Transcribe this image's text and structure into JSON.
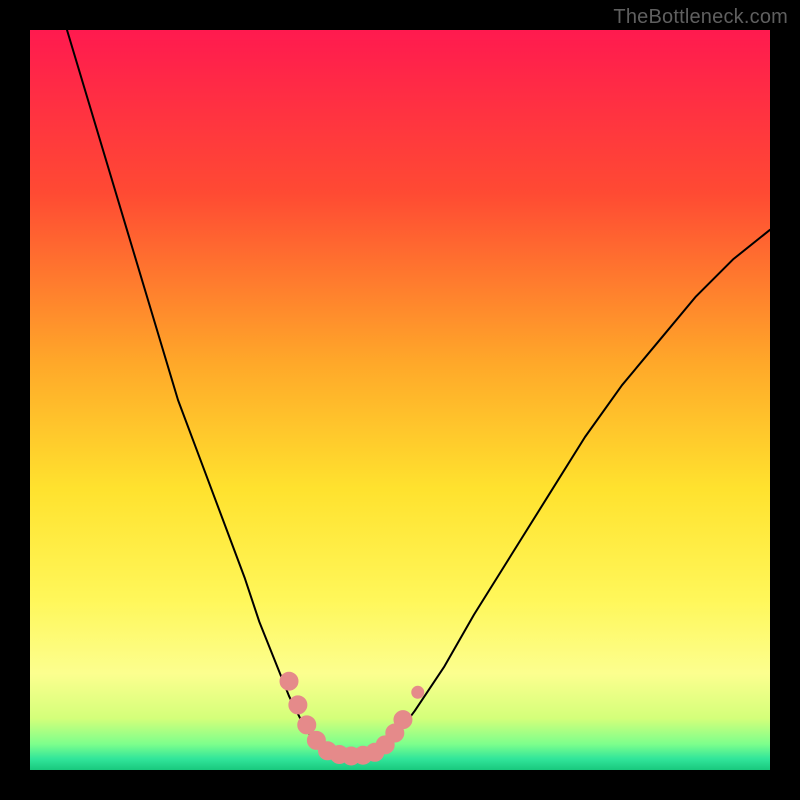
{
  "watermark": "TheBottleneck.com",
  "chart_data": {
    "type": "line",
    "title": "",
    "xlabel": "",
    "ylabel": "",
    "xlim": [
      0,
      100
    ],
    "ylim": [
      0,
      100
    ],
    "grid": false,
    "legend": false,
    "background_gradient_stops": [
      {
        "offset": 0,
        "color": "#ff1a4f"
      },
      {
        "offset": 0.22,
        "color": "#ff4a33"
      },
      {
        "offset": 0.45,
        "color": "#ffa829"
      },
      {
        "offset": 0.62,
        "color": "#ffe22e"
      },
      {
        "offset": 0.77,
        "color": "#fff75a"
      },
      {
        "offset": 0.87,
        "color": "#fcff8f"
      },
      {
        "offset": 0.93,
        "color": "#d4ff7a"
      },
      {
        "offset": 0.965,
        "color": "#7dff8c"
      },
      {
        "offset": 0.985,
        "color": "#31e59a"
      },
      {
        "offset": 1.0,
        "color": "#19c87d"
      }
    ],
    "series": [
      {
        "name": "left-curve",
        "stroke": "#000000",
        "stroke_width": 2,
        "x": [
          5,
          8,
          11,
          14,
          17,
          20,
          23,
          26,
          29,
          31,
          33,
          35,
          36.5,
          38,
          39,
          40
        ],
        "y": [
          100,
          90,
          80,
          70,
          60,
          50,
          42,
          34,
          26,
          20,
          15,
          10,
          7,
          4.5,
          3,
          2.5
        ]
      },
      {
        "name": "right-curve",
        "stroke": "#000000",
        "stroke_width": 2,
        "x": [
          47,
          49,
          52,
          56,
          60,
          65,
          70,
          75,
          80,
          85,
          90,
          95,
          100
        ],
        "y": [
          2.5,
          4,
          8,
          14,
          21,
          29,
          37,
          45,
          52,
          58,
          64,
          69,
          73
        ]
      },
      {
        "name": "trough",
        "stroke": "#000000",
        "stroke_width": 2,
        "x": [
          40,
          41.5,
          43,
          44.5,
          46,
          47
        ],
        "y": [
          2.5,
          2.0,
          1.8,
          1.8,
          2.0,
          2.5
        ]
      }
    ],
    "markers": {
      "name": "highlight-points",
      "fill": "#e58a8a",
      "stroke": "#e58a8a",
      "radius_main": 9,
      "radius_small": 6,
      "points": [
        {
          "x": 35.0,
          "y": 12.0,
          "r": 9
        },
        {
          "x": 36.2,
          "y": 8.8,
          "r": 9
        },
        {
          "x": 37.4,
          "y": 6.1,
          "r": 9
        },
        {
          "x": 38.7,
          "y": 4.0,
          "r": 9
        },
        {
          "x": 40.2,
          "y": 2.6,
          "r": 9
        },
        {
          "x": 41.8,
          "y": 2.1,
          "r": 9
        },
        {
          "x": 43.4,
          "y": 1.9,
          "r": 9
        },
        {
          "x": 45.0,
          "y": 2.0,
          "r": 9
        },
        {
          "x": 46.6,
          "y": 2.4,
          "r": 9
        },
        {
          "x": 48.0,
          "y": 3.4,
          "r": 9
        },
        {
          "x": 49.3,
          "y": 5.0,
          "r": 9
        },
        {
          "x": 50.4,
          "y": 6.8,
          "r": 9
        },
        {
          "x": 52.4,
          "y": 10.5,
          "r": 6
        }
      ]
    }
  }
}
